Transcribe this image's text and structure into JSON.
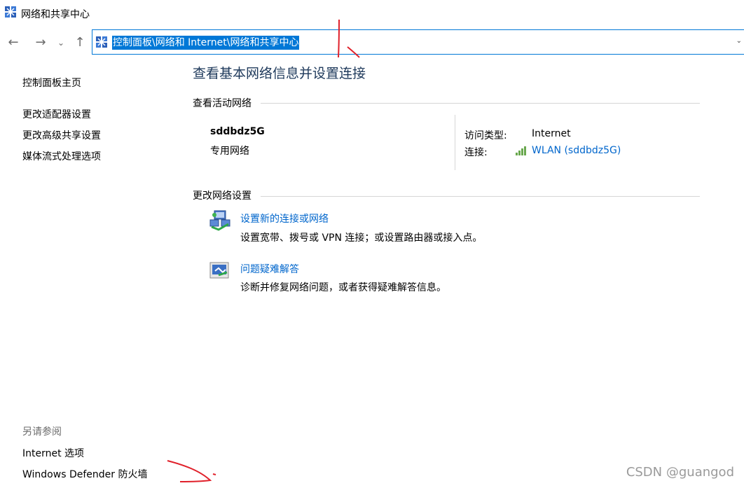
{
  "window": {
    "title": "网络和共享中心",
    "icon": "network-center-icon"
  },
  "nav": {
    "back": "←",
    "forward": "→",
    "recent": "⌄",
    "up": "↑",
    "address": "控制面板\\网络和 Internet\\网络和共享中心",
    "address_chevron": "⌄"
  },
  "sidebar": {
    "home": "控制面板主页",
    "items": [
      "更改适配器设置",
      "更改高级共享设置",
      "媒体流式处理选项"
    ],
    "see_also_title": "另请参阅",
    "see_also": [
      "Internet 选项",
      "Windows Defender 防火墙"
    ]
  },
  "main": {
    "title": "查看基本网络信息并设置连接",
    "active_networks_header": "查看活动网络",
    "network": {
      "name": "sddbdz5G",
      "category": "专用网络",
      "access_type_label": "访问类型:",
      "access_type_value": "Internet",
      "connection_label": "连接:",
      "connection_value": "WLAN (sddbdz5G)"
    },
    "change_settings_header": "更改网络设置",
    "tasks": [
      {
        "link": "设置新的连接或网络",
        "description": "设置宽带、拨号或 VPN 连接；或设置路由器或接入点。",
        "icon": "new-connection-icon"
      },
      {
        "link": "问题疑难解答",
        "description": "诊断并修复网络问题，或者获得疑难解答信息。",
        "icon": "troubleshoot-icon"
      }
    ]
  },
  "watermark": "CSDN @guangod",
  "colors": {
    "accent": "#0078d7",
    "link": "#0066cc",
    "title": "#1e395b",
    "annotation": "#e0202a"
  }
}
